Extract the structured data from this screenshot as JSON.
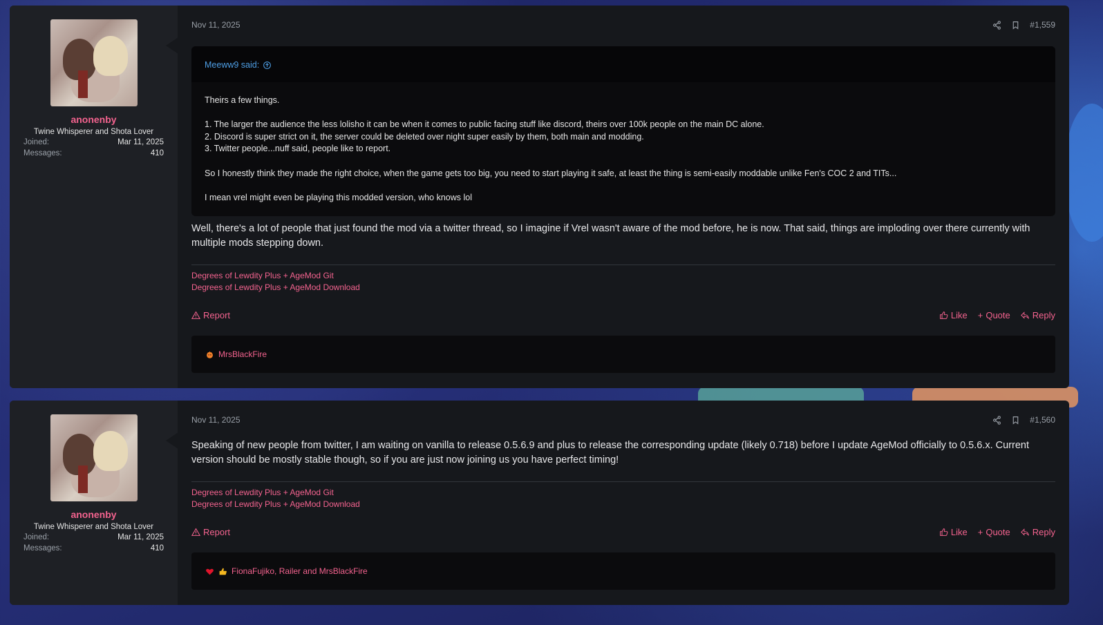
{
  "posts": [
    {
      "user": {
        "name": "anonenby",
        "title": "Twine Whisperer and Shota Lover",
        "joined_label": "Joined:",
        "joined_value": "Mar 11, 2025",
        "messages_label": "Messages:",
        "messages_value": "410"
      },
      "date": "Nov 11, 2025",
      "number": "#1,559",
      "quote": {
        "author": "Meeww9 said:",
        "lines": [
          "Theirs a few things.",
          "",
          "1. The larger the audience the less lolisho it can be when it comes to public facing stuff like discord, theirs over 100k people on the main DC alone.",
          "2. Discord is super strict on it, the server could be deleted over night super easily by them, both main and modding.",
          "3. Twitter people...nuff said, people like to report.",
          "",
          "So I honestly think they made the right choice, when the game gets too big, you need to start playing it safe, at least the thing is semi-easily moddable unlike Fen's COC 2 and TITs...",
          "",
          "I mean vrel might even be playing this modded version, who knows lol"
        ]
      },
      "message": "Well, there's a lot of people that just found the mod via a twitter thread, so I imagine if Vrel wasn't aware of the mod before, he is now. That said, things are imploding over there currently with multiple mods stepping down.",
      "signature": [
        "Degrees of Lewdity Plus + AgeMod Git",
        "Degrees of Lewdity Plus + AgeMod Download"
      ],
      "actions": {
        "report": "Report",
        "like": "Like",
        "quote": "Quote",
        "reply": "Reply"
      },
      "reactions": "MrsBlackFire"
    },
    {
      "user": {
        "name": "anonenby",
        "title": "Twine Whisperer and Shota Lover",
        "joined_label": "Joined:",
        "joined_value": "Mar 11, 2025",
        "messages_label": "Messages:",
        "messages_value": "410"
      },
      "date": "Nov 11, 2025",
      "number": "#1,560",
      "message": "Speaking of new people from twitter, I am waiting on vanilla to release 0.5.6.9 and plus to release the corresponding update (likely 0.718) before I update AgeMod officially to 0.5.6.x. Current version should be mostly stable though, so if you are just now joining us you have perfect timing!",
      "signature": [
        "Degrees of Lewdity Plus + AgeMod Git",
        "Degrees of Lewdity Plus + AgeMod Download"
      ],
      "actions": {
        "report": "Report",
        "like": "Like",
        "quote": "Quote",
        "reply": "Reply"
      },
      "reactions": "FionaFujiko, Railer and MrsBlackFire"
    }
  ],
  "colors": {
    "accent": "#f4638f",
    "quote_link": "#4e9ee4",
    "panel": "#16181c",
    "user_panel": "#1e2025"
  }
}
